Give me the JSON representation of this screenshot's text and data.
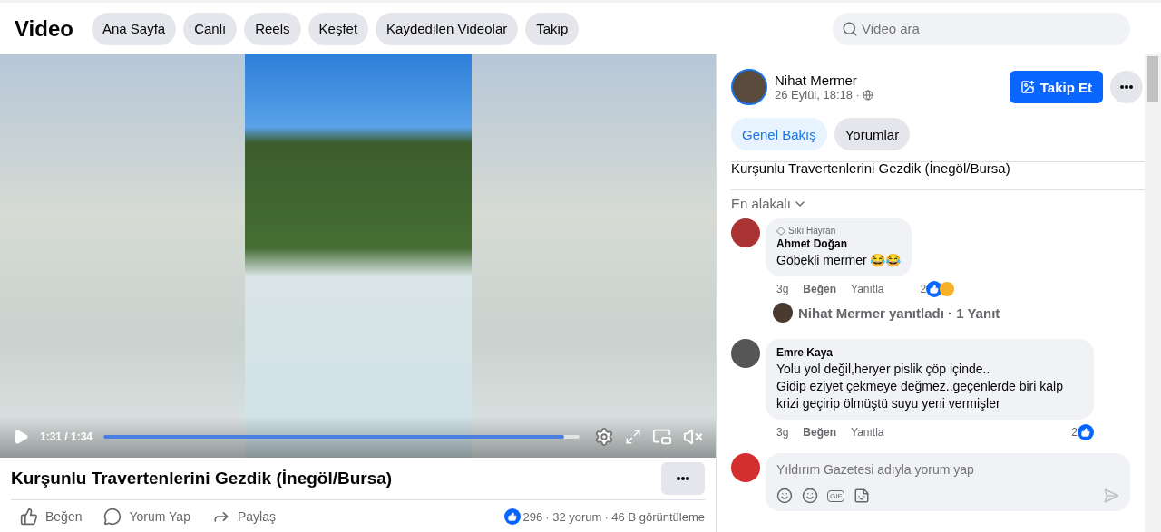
{
  "header": {
    "title": "Video",
    "nav": [
      {
        "label": "Ana Sayfa",
        "selected": false
      },
      {
        "label": "Canlı",
        "selected": false
      },
      {
        "label": "Reels",
        "selected": false
      },
      {
        "label": "Keşfet",
        "selected": false
      },
      {
        "label": "Kaydedilen Videolar",
        "selected": false
      },
      {
        "label": "Takip",
        "selected": false
      }
    ],
    "search": {
      "placeholder": "Video ara"
    }
  },
  "player": {
    "time": "1:31 / 1:34",
    "progress": {
      "level": 0.968
    },
    "muted": true
  },
  "video": {
    "title": "Kurşunlu Travertenlerini Gezdik (İnegöl/Bursa)",
    "actions": [
      {
        "kind": "like",
        "label": "Beğen"
      },
      {
        "kind": "comment",
        "label": "Yorum Yap"
      },
      {
        "kind": "share",
        "label": "Paylaş"
      }
    ],
    "reaction_count": "296",
    "comments": "· 32 yorum",
    "views": "· 46 B görüntüleme"
  },
  "post": {
    "author": "Nihat Mermer",
    "date": "26 Eylül, 18:18 ·",
    "follow": "Takip Et",
    "tabs": [
      {
        "label": "Genel Bakış",
        "selected": true
      },
      {
        "label": "Yorumlar",
        "selected": false
      }
    ],
    "description": "Kurşunlu Travertenlerini Gezdik (İnegöl/Bursa)",
    "sort": "En alakalı",
    "comments": [
      {
        "badge": "Sıkı Hayran",
        "author": "Ahmet Doğan",
        "text": "Göbekli mermer 😂😂",
        "time": "3g",
        "like": "Beğen",
        "reply": "Yanıtla",
        "count": "2",
        "reactions": [
          {
            "kind": "like"
          },
          {
            "kind": "haha"
          }
        ],
        "replies": "Nihat Mermer yanıtladı · 1 Yanıt"
      },
      {
        "author": "Emre Kaya",
        "text": "Yolu yol değil,heryer pislik çöp içinde..\nGidip eziyet çekmeye değmez..geçenlerde biri kalp krizi geçirip ölmüştü suyu yeni vermişler",
        "time": "3g",
        "like": "Beğen",
        "reply": "Yanıtla",
        "count": "2",
        "reactions": [
          {
            "kind": "like"
          }
        ]
      }
    ],
    "composer": {
      "placeholder": "Yıldırım Gazetesi adıyla yorum yap",
      "gif": "GIF"
    }
  }
}
